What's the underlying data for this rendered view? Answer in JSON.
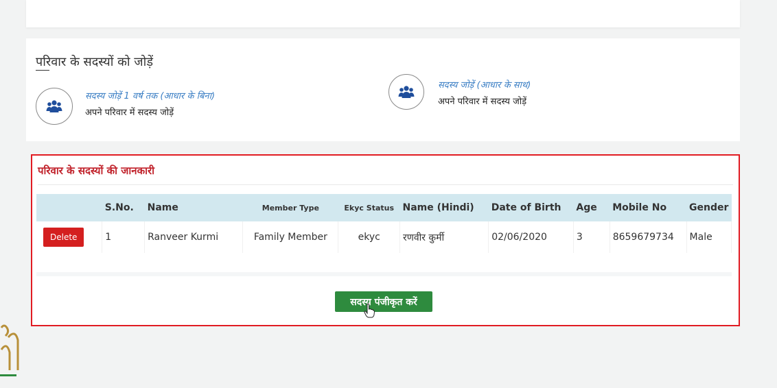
{
  "add_section": {
    "title": "परिवार के सदस्यों को जोड़ें",
    "option_without_aadhaar": {
      "link": "सदस्य जोड़ें 1 वर्ष तक (आधार के बिना)",
      "subtitle": "अपने परिवार में सदस्य जोड़ें",
      "icon": "users-icon"
    },
    "option_with_aadhaar": {
      "link": "सदस्य जोड़ें (आधार के साथ)",
      "subtitle": "अपने परिवार में सदस्य जोड़ें",
      "icon": "users-icon"
    }
  },
  "info_section": {
    "title": "परिवार के सदस्यों की जानकारी",
    "columns": [
      "",
      "S.No.",
      "Name",
      "Member Type",
      "Ekyc Status",
      "Name (Hindi)",
      "Date of Birth",
      "Age",
      "Mobile No",
      "Gender"
    ],
    "rows": [
      {
        "action": "Delete",
        "sno": "1",
        "name": "Ranveer Kurmi",
        "member_type": "Family Member",
        "ekyc_status": "ekyc",
        "name_hindi": "रणवीर कुर्मी",
        "dob": "02/06/2020",
        "age": "3",
        "mobile": "8659679734",
        "gender": "Male"
      }
    ],
    "register_button": "सदस्य पंजीकृत करें"
  },
  "colors": {
    "highlight_border": "#e11b22",
    "title_red": "#c0212a",
    "header_bg": "#d2e8ef",
    "delete_btn": "#d41f1f",
    "register_btn": "#2e8b3e",
    "link_blue": "#3a7ec4",
    "icon_blue": "#1f4e9c"
  }
}
